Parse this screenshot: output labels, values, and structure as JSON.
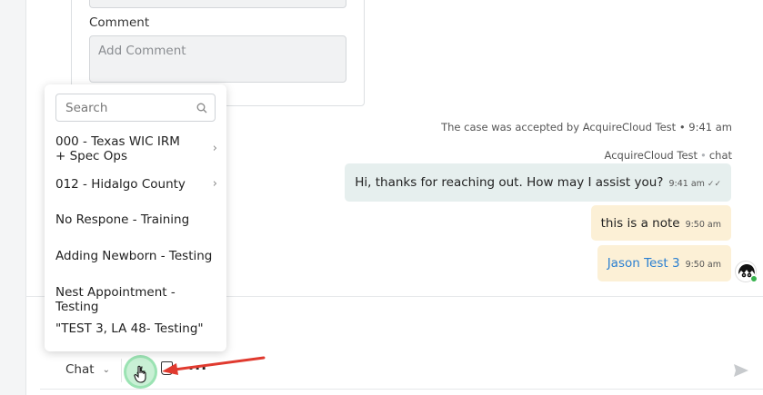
{
  "form": {
    "comment_label": "Comment",
    "comment_placeholder": "Add Comment"
  },
  "conversation": {
    "system_message": "The case was accepted by AcquireCloud Test • 9:41 am",
    "sender": "AcquireCloud Test",
    "channel": "chat",
    "messages": [
      {
        "text": "Hi, thanks for reaching out. How may I assist you?",
        "time": "9:41 am",
        "type": "agent"
      },
      {
        "text": "this is a note",
        "time": "9:50 am",
        "type": "note"
      },
      {
        "text": "Jason Test 3",
        "time": "9:50 am",
        "type": "link"
      }
    ]
  },
  "quick_text_menu": {
    "search_placeholder": "Search",
    "items": [
      {
        "label": "000 - Texas WIC IRM + Spec Ops",
        "has_submenu": true
      },
      {
        "label": "012 - Hidalgo County",
        "has_submenu": true
      },
      {
        "label": "No Respone - Training",
        "has_submenu": false
      },
      {
        "label": "Adding Newborn - Testing",
        "has_submenu": false
      },
      {
        "label": "Nest Appointment - Testing",
        "has_submenu": false
      },
      {
        "label": "\"TEST 3, LA 48- Testing\"",
        "has_submenu": false
      }
    ]
  },
  "composer": {
    "channel_label": "Chat",
    "icons": [
      "quick-text-icon",
      "attach-icon",
      "more-icon",
      "send-icon"
    ],
    "more_label": "···"
  },
  "colors": {
    "agent_bubble": "#e6efee",
    "note_bubble": "#fcf0d6",
    "link": "#2a7fd1",
    "highlight": "#9be3b3",
    "annotation_arrow": "#e03a2f"
  }
}
